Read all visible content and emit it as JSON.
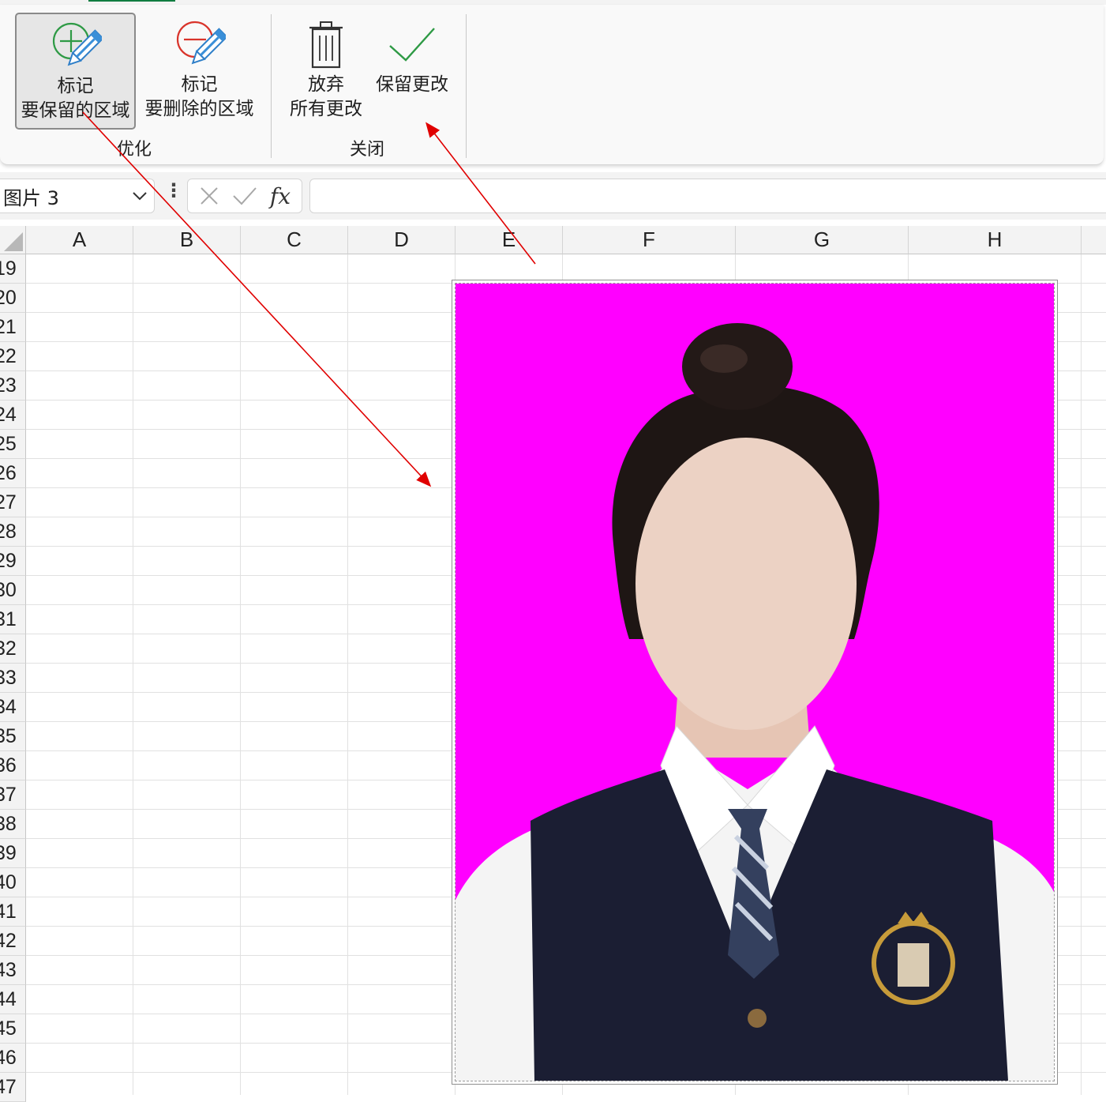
{
  "ribbon": {
    "buttons": [
      {
        "line1": "标记",
        "line2": "要保留的区域",
        "icon": "mark-keep-icon",
        "selected": true
      },
      {
        "line1": "标记",
        "line2": "要删除的区域",
        "icon": "mark-remove-icon",
        "selected": false
      },
      {
        "line1": "放弃",
        "line2": "所有更改",
        "icon": "trash-icon",
        "selected": false
      },
      {
        "line1": "保留更改",
        "line2": "",
        "icon": "checkmark-icon",
        "selected": false
      }
    ],
    "groups": [
      "优化",
      "关闭"
    ]
  },
  "formula_bar": {
    "name_box": "图片 3",
    "fx_label": "fx",
    "formula": ""
  },
  "grid": {
    "columns": [
      "A",
      "B",
      "C",
      "D",
      "E",
      "F",
      "G",
      "H"
    ],
    "rows": [
      "19",
      "20",
      "21",
      "22",
      "23",
      "24",
      "25",
      "26",
      "27",
      "28",
      "29",
      "30",
      "31",
      "32",
      "33",
      "34",
      "35",
      "36",
      "37",
      "38",
      "39",
      "40",
      "41",
      "42",
      "43",
      "44",
      "45",
      "46",
      "47"
    ]
  },
  "picture": {
    "name": "图片 3",
    "background_color": "#ff00ff",
    "content": "id-photo-portrait"
  },
  "colors": {
    "keep_plus": "#2e9a45",
    "remove_minus": "#d9342b",
    "pencil_blue": "#3a8fd8",
    "check_green": "#2e9a45",
    "annotation_arrow": "#e00000",
    "excel_green": "#107c41"
  }
}
